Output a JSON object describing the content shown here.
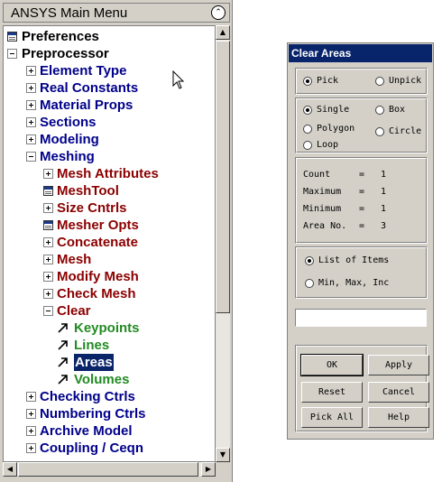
{
  "main_menu": {
    "title": "ANSYS Main Menu",
    "tree": [
      {
        "label": "Preferences",
        "icon": "dialog-icon",
        "color": "black"
      },
      {
        "label": "Preprocessor",
        "icon": "minus-icon",
        "color": "black"
      },
      {
        "label": "Element Type",
        "icon": "plus-icon",
        "color": "navy"
      },
      {
        "label": "Real Constants",
        "icon": "plus-icon",
        "color": "navy"
      },
      {
        "label": "Material Props",
        "icon": "plus-icon",
        "color": "navy"
      },
      {
        "label": "Sections",
        "icon": "plus-icon",
        "color": "navy"
      },
      {
        "label": "Modeling",
        "icon": "plus-icon",
        "color": "navy"
      },
      {
        "label": "Meshing",
        "icon": "minus-icon",
        "color": "navy"
      },
      {
        "label": "Mesh Attributes",
        "icon": "plus-icon",
        "color": "red"
      },
      {
        "label": "MeshTool",
        "icon": "dialog-icon",
        "color": "red"
      },
      {
        "label": "Size Cntrls",
        "icon": "plus-icon",
        "color": "red"
      },
      {
        "label": "Mesher Opts",
        "icon": "dialog-icon",
        "color": "red"
      },
      {
        "label": "Concatenate",
        "icon": "plus-icon",
        "color": "red"
      },
      {
        "label": "Mesh",
        "icon": "plus-icon",
        "color": "red"
      },
      {
        "label": "Modify Mesh",
        "icon": "plus-icon",
        "color": "red"
      },
      {
        "label": "Check Mesh",
        "icon": "plus-icon",
        "color": "red"
      },
      {
        "label": "Clear",
        "icon": "minus-icon",
        "color": "red"
      },
      {
        "label": "Keypoints",
        "icon": "pick-arrow-icon",
        "color": "green"
      },
      {
        "label": "Lines",
        "icon": "pick-arrow-icon",
        "color": "green"
      },
      {
        "label": "Areas",
        "icon": "pick-arrow-icon",
        "color": "green",
        "selected": true
      },
      {
        "label": "Volumes",
        "icon": "pick-arrow-icon",
        "color": "green"
      },
      {
        "label": "Checking Ctrls",
        "icon": "plus-icon",
        "color": "navy"
      },
      {
        "label": "Numbering Ctrls",
        "icon": "plus-icon",
        "color": "navy"
      },
      {
        "label": "Archive Model",
        "icon": "plus-icon",
        "color": "navy"
      },
      {
        "label": "Coupling / Ceqn",
        "icon": "plus-icon",
        "color": "navy"
      }
    ]
  },
  "dialog": {
    "title": "Clear Areas",
    "pick_mode": {
      "options": [
        "Pick",
        "Unpick"
      ],
      "selected": "Pick"
    },
    "pick_shape": {
      "options": [
        "Single",
        "Box",
        "Polygon",
        "Circle",
        "Loop"
      ],
      "selected": "Single"
    },
    "stats": [
      {
        "label": "Count",
        "value": "1"
      },
      {
        "label": "Maximum",
        "value": "1"
      },
      {
        "label": "Minimum",
        "value": "1"
      },
      {
        "label": "Area No.",
        "value": "3"
      }
    ],
    "stats_separator": "=",
    "entry_mode": {
      "options": [
        "List of Items",
        "Min, Max, Inc"
      ],
      "selected": "List of Items"
    },
    "input_value": "",
    "buttons": {
      "ok": "OK",
      "apply": "Apply",
      "reset": "Reset",
      "cancel": "Cancel",
      "pick_all": "Pick All",
      "help": "Help"
    }
  },
  "colors": {
    "black": "#000000",
    "navy": "#00008b",
    "red": "#8b0000",
    "green": "#228b22",
    "title_bar": "#08246b",
    "selection": "#0a246a"
  }
}
